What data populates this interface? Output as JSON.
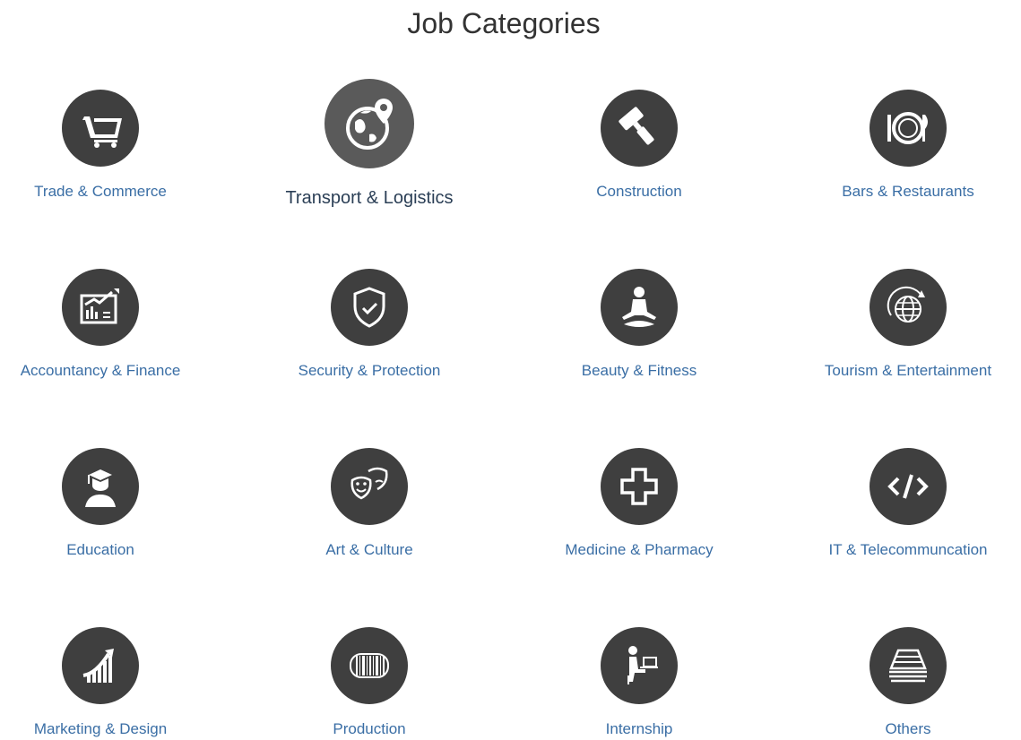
{
  "page": {
    "title": "Job Categories"
  },
  "colors": {
    "icon_bg": "#3f3f3f",
    "icon_bg_hover": "#5a5a5a",
    "link": "#3a6ea5",
    "link_hover": "#2b3f56",
    "title": "#333333"
  },
  "categories": [
    {
      "label": "Trade & Commerce",
      "icon": "shopping-cart-icon"
    },
    {
      "label": "Transport & Logistics",
      "icon": "globe-location-icon"
    },
    {
      "label": "Construction",
      "icon": "paint-roller-icon"
    },
    {
      "label": "Bars & Restaurants",
      "icon": "plate-cutlery-icon"
    },
    {
      "label": "Accountancy & Finance",
      "icon": "finance-chart-icon"
    },
    {
      "label": "Security & Protection",
      "icon": "shield-check-icon"
    },
    {
      "label": "Beauty & Fitness",
      "icon": "yoga-person-icon"
    },
    {
      "label": "Tourism & Entertainment",
      "icon": "globe-orbit-icon"
    },
    {
      "label": "Education",
      "icon": "graduate-icon"
    },
    {
      "label": "Art & Culture",
      "icon": "theater-masks-icon"
    },
    {
      "label": "Medicine & Pharmacy",
      "icon": "medical-cross-icon"
    },
    {
      "label": "IT & Telecommuncation",
      "icon": "code-brackets-icon"
    },
    {
      "label": "Marketing & Design",
      "icon": "growth-chart-icon"
    },
    {
      "label": "Production",
      "icon": "barcode-icon"
    },
    {
      "label": "Internship",
      "icon": "person-laptop-icon"
    },
    {
      "label": "Others",
      "icon": "stack-lines-icon"
    }
  ]
}
